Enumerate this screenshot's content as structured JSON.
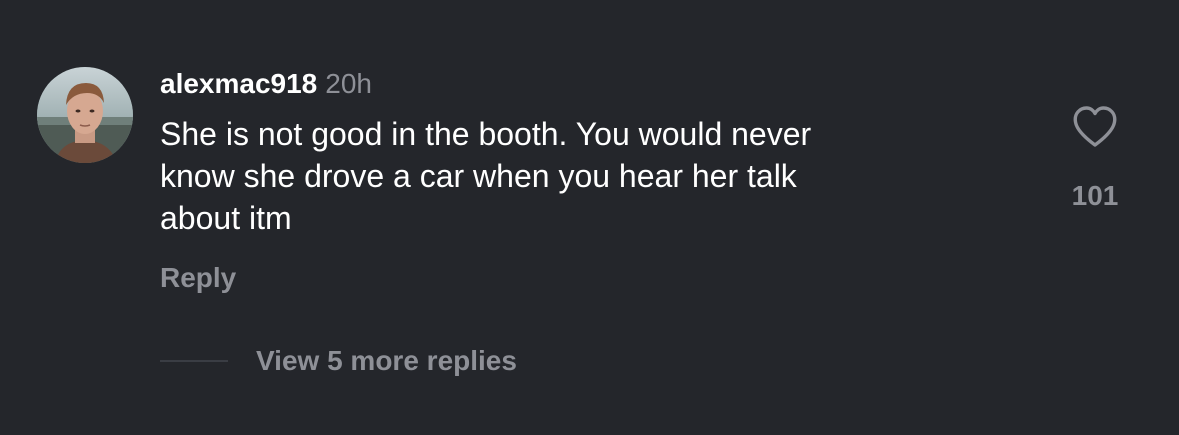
{
  "comment": {
    "avatar_icon": "user-avatar-photo",
    "username": "alexmac918",
    "time": "20h",
    "text": "She is not good in the booth.  You would never\nknow she drove a car when you hear her talk\nabout itm",
    "reply_label": "Reply",
    "like_icon": "heart-outline-icon",
    "like_count": "101",
    "view_more_label": "View 5 more replies"
  },
  "colors": {
    "background": "#24262b",
    "primary_text": "#ffffff",
    "secondary_text": "#8e9097"
  }
}
